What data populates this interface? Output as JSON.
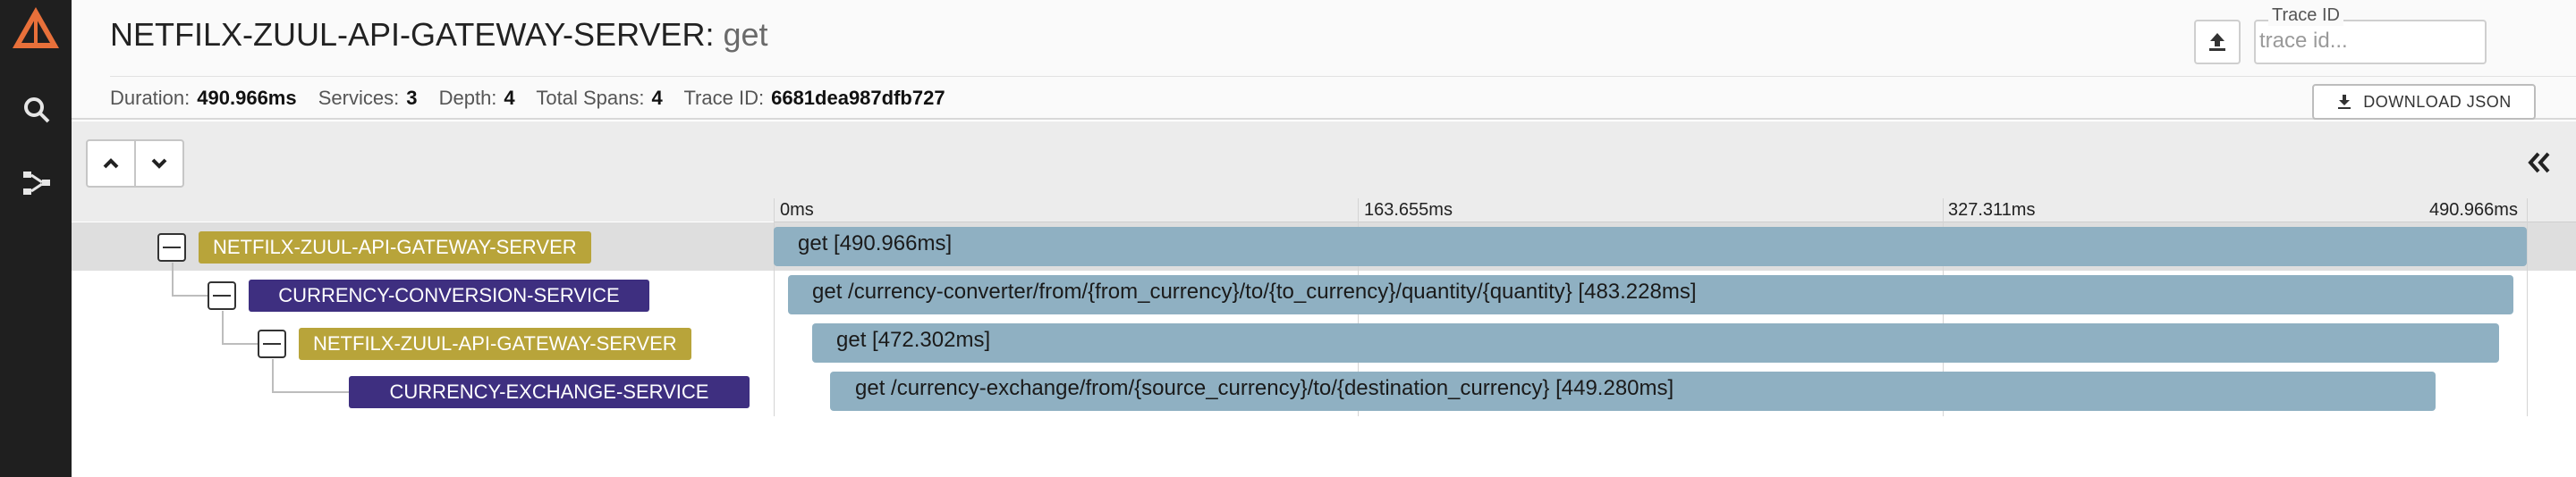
{
  "header": {
    "service": "NETFILX-ZUUL-API-GATEWAY-SERVER",
    "separator": ":",
    "operation": "get",
    "summary": {
      "duration_label": "Duration:",
      "duration_value": "490.966ms",
      "services_label": "Services:",
      "services_value": "3",
      "depth_label": "Depth:",
      "depth_value": "4",
      "spans_label": "Total Spans:",
      "spans_value": "4",
      "traceid_label": "Trace ID:",
      "traceid_value": "6681dea987dfb727"
    },
    "trace_search": {
      "legend": "Trace ID",
      "placeholder": "trace id...",
      "value": ""
    },
    "download_label": "DOWNLOAD JSON"
  },
  "sidebar": {
    "icons": [
      "logo-icon",
      "search-icon",
      "dependencies-icon"
    ]
  },
  "timeline": {
    "ticks": [
      "0ms",
      "163.655ms",
      "327.311ms",
      "490.966ms"
    ],
    "spans": [
      {
        "service": "NETFILX-ZUUL-API-GATEWAY-SERVER",
        "label": "get [490.966ms]"
      },
      {
        "service": "CURRENCY-CONVERSION-SERVICE",
        "label": "get /currency-converter/from/{from_currency}/to/{to_currency}/quantity/{quantity} [483.228ms]"
      },
      {
        "service": "NETFILX-ZUUL-API-GATEWAY-SERVER",
        "label": "get [472.302ms]"
      },
      {
        "service": "CURRENCY-EXCHANGE-SERVICE",
        "label": "get /currency-exchange/from/{source_currency}/to/{destination_currency} [449.280ms]"
      }
    ]
  },
  "colors": {
    "gateway": "#b8a43a",
    "conversion": "#3e2f80",
    "exchange": "#3e2f80",
    "bar": "#8fb0c2",
    "logo": "#e8703a"
  }
}
